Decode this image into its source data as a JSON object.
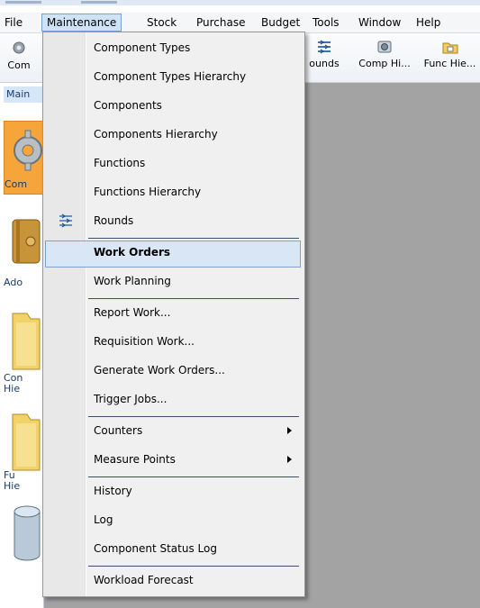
{
  "menubar": {
    "items": [
      "File",
      "Maintenance",
      "Stock",
      "Purchase",
      "Budget",
      "Tools",
      "Window",
      "Help"
    ],
    "active": "Maintenance"
  },
  "toolbar": {
    "left_label": "Com",
    "rounds_label": "ounds",
    "comp_hierarchy_label": "Comp Hi...",
    "func_hierarchy_label": "Func Hie..."
  },
  "leftpane": {
    "header": "Main",
    "items": [
      {
        "label": "Com",
        "icon": "component-gear-icon"
      },
      {
        "label": "Ado",
        "icon": "book-icon"
      },
      {
        "label": "Con\nHie",
        "icon": "folder-icon"
      },
      {
        "label": "Fu\nHie",
        "icon": "folder-icon"
      },
      {
        "label": "",
        "icon": "cylinder-icon"
      }
    ]
  },
  "dropdown": {
    "items": [
      {
        "label": "Component Types"
      },
      {
        "label": "Component Types Hierarchy"
      },
      {
        "label": "Components"
      },
      {
        "label": "Components Hierarchy"
      },
      {
        "label": "Functions"
      },
      {
        "label": "Functions Hierarchy"
      },
      {
        "label": "Rounds",
        "icon": "rounds-icon"
      },
      {
        "label": "Work Orders"
      },
      {
        "label": "Work Planning"
      },
      {
        "label": "Report Work..."
      },
      {
        "label": "Requisition Work..."
      },
      {
        "label": "Generate Work Orders..."
      },
      {
        "label": "Trigger Jobs..."
      },
      {
        "label": "Counters",
        "submenu": true
      },
      {
        "label": "Measure Points",
        "submenu": true
      },
      {
        "label": "History"
      },
      {
        "label": "Log"
      },
      {
        "label": "Component Status Log"
      },
      {
        "label": "Workload Forecast"
      }
    ],
    "highlighted": "Work Orders"
  },
  "colors": {
    "menu_highlight": "#d8e6f6",
    "menu_highlight_border": "#7da2ce",
    "workspace": "#a3a3a3",
    "separator": "#3d4e6b"
  }
}
